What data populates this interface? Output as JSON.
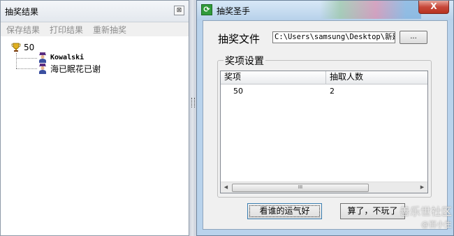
{
  "left_window": {
    "title": "抽奖结果",
    "close_label": "⊠",
    "toolbar": [
      "保存结果",
      "打印结果",
      "重新抽奖"
    ],
    "tree": {
      "root_label": "50",
      "root_icon": "trophy-icon",
      "children": [
        {
          "label": "Kowalski",
          "icon": "person-icon"
        },
        {
          "label": "海已眠花已谢",
          "icon": "person-icon"
        }
      ]
    }
  },
  "dialog": {
    "title": "抽奖圣手",
    "app_icon": "refresh-icon",
    "close_label": "X",
    "file_label": "抽奖文件",
    "file_path": "C:\\Users\\samsung\\Desktop\\新建",
    "browse_label": "...",
    "group_title": "奖项设置",
    "columns": [
      "奖项",
      "抽取人数"
    ],
    "rows": [
      [
        "50",
        "2"
      ]
    ],
    "scroll_thumb": "III",
    "button_lucky": "看谁的运气好",
    "button_quit": "算了，不玩了"
  },
  "watermark": {
    "line1": "善乐世社区",
    "line2": "@百小生"
  }
}
